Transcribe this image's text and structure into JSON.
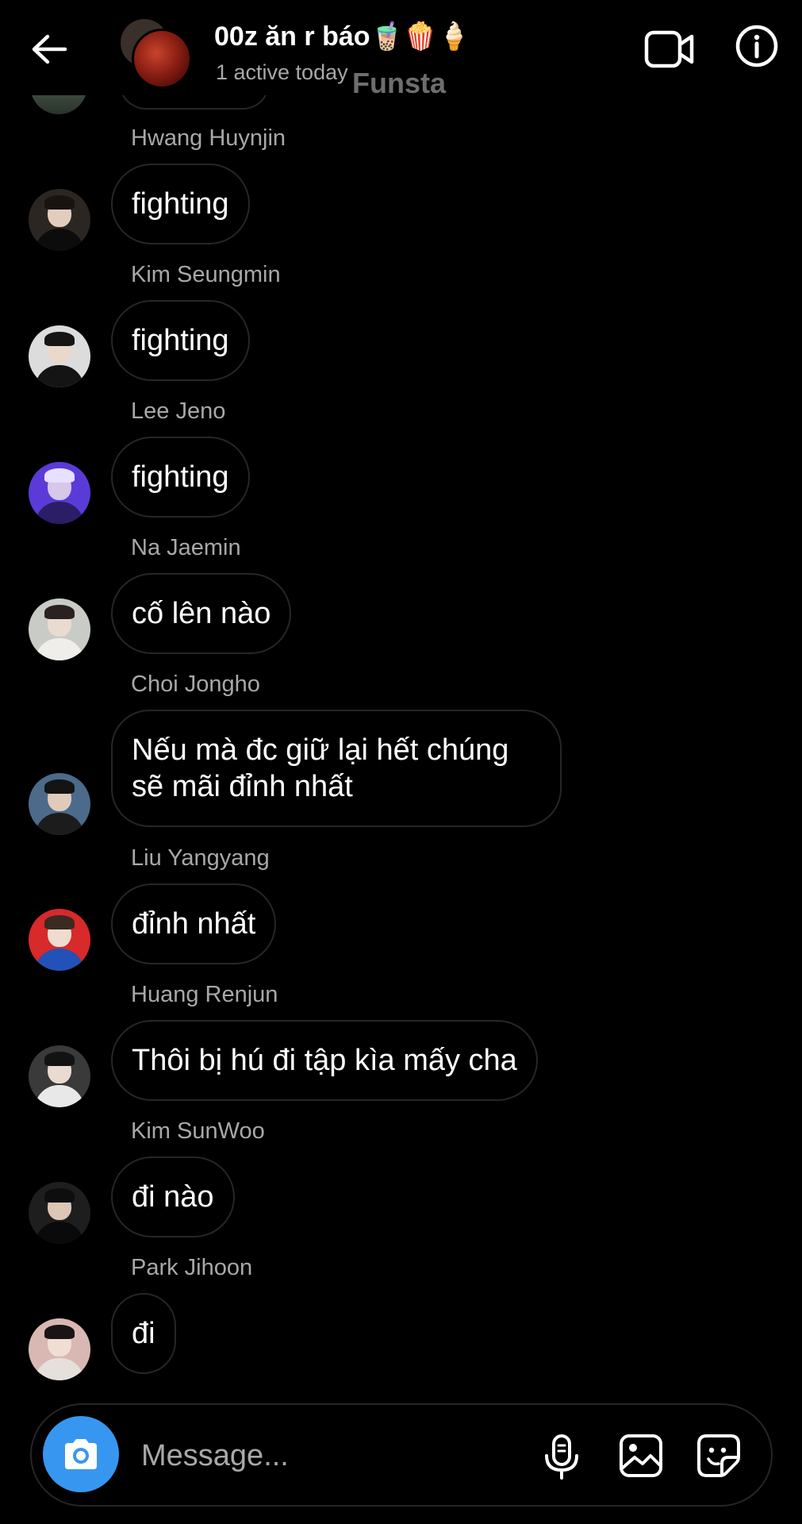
{
  "header": {
    "title": "00z ăn r báo🧋🍿🍦",
    "subtitle": "1 active today",
    "watermark": "Funsta",
    "back_icon": "arrow-left-icon",
    "video_icon": "video-call-icon",
    "info_icon": "info-icon"
  },
  "messages": [
    {
      "sender": "Hwang Huynjin",
      "text": "fighting",
      "avatar": {
        "bg": "#2c2622",
        "face": "#e2cdbd",
        "hair": "#1a1410",
        "body": "#0c0c0c"
      }
    },
    {
      "sender": "Kim Seungmin",
      "text": "fighting",
      "avatar": {
        "bg": "#dcdcdc",
        "face": "#ead8cb",
        "hair": "#151515",
        "body": "#141414"
      }
    },
    {
      "sender": "Lee Jeno",
      "text": "fighting",
      "avatar": {
        "bg": "#5a3bd8",
        "face": "#d7c7e8",
        "hair": "#e8e0ff",
        "body": "#2b1e66"
      }
    },
    {
      "sender": "Na Jaemin",
      "text": "cố lên nào",
      "avatar": {
        "bg": "#c9cbc6",
        "face": "#eadbd0",
        "hair": "#2a2220",
        "body": "#f0eeea"
      }
    },
    {
      "sender": "Choi Jongho",
      "text_lines": [
        "Nếu mà đc giữ lại hết chúng",
        "sẽ mãi đỉnh nhất"
      ],
      "avatar": {
        "bg": "#4c6a8a",
        "face": "#e0cbbb",
        "hair": "#141414",
        "body": "#1c1c1c"
      }
    },
    {
      "sender": "Liu Yangyang",
      "text": "đỉnh nhất",
      "avatar": {
        "bg": "#d8292b",
        "face": "#efdccf",
        "hair": "#3a2a22",
        "body": "#2251b8"
      }
    },
    {
      "sender": "Huang Renjun",
      "text": "Thôi bị hú đi tập kìa mấy cha",
      "avatar": {
        "bg": "#3a3a3a",
        "face": "#eadad0",
        "hair": "#121212",
        "body": "#e8e8e8"
      }
    },
    {
      "sender": "Kim SunWoo",
      "text": "đi nào",
      "avatar": {
        "bg": "#1e1e1e",
        "face": "#dcc6b6",
        "hair": "#0e0e0e",
        "body": "#0a0a0a"
      }
    },
    {
      "sender": "Park Jihoon",
      "text": "đi",
      "avatar": {
        "bg": "#d9b8b4",
        "face": "#f0ddd3",
        "hair": "#1a1414",
        "body": "#e6e0dc"
      }
    }
  ],
  "composer": {
    "placeholder": "Message...",
    "camera_icon": "camera-icon",
    "mic_icon": "microphone-icon",
    "gallery_icon": "gallery-icon",
    "sticker_icon": "sticker-icon",
    "camera_color": "#3797f0"
  }
}
